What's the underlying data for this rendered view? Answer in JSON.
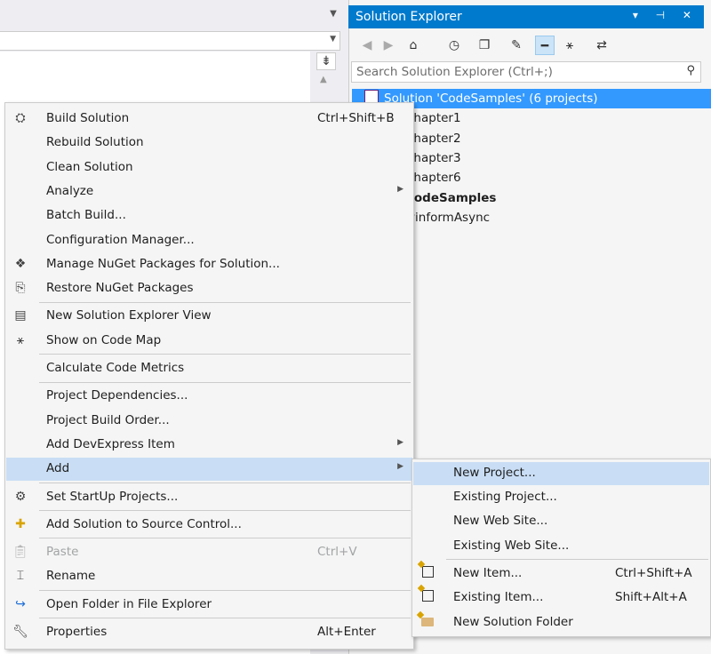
{
  "solution_explorer": {
    "title": "Solution Explorer",
    "title_buttons": "▾ ⊣ ✕",
    "search_placeholder": "Search Solution Explorer (Ctrl+;)",
    "search_icon": "⚲",
    "toolbar_icons": [
      "back-icon",
      "forward-icon",
      "home-icon",
      "history-icon",
      "collapse-all-icon",
      "properties-icon",
      "preview-icon",
      "code-map-icon",
      "sync-icon"
    ],
    "tree": [
      {
        "label": "Solution 'CodeSamples' (6 projects)",
        "selected": true
      },
      {
        "label": "Chapter1"
      },
      {
        "label": "Chapter2"
      },
      {
        "label": "Chapter3"
      },
      {
        "label": "Chapter6"
      },
      {
        "label": "CodeSamples",
        "bold": true
      },
      {
        "label": "winformAsync"
      }
    ]
  },
  "context_menu": {
    "build_solution": {
      "label": "Build Solution",
      "shortcut": "Ctrl+Shift+B"
    },
    "rebuild_solution": {
      "label": "Rebuild Solution"
    },
    "clean_solution": {
      "label": "Clean Solution"
    },
    "analyze": {
      "label": "Analyze"
    },
    "batch_build": {
      "label": "Batch Build..."
    },
    "configuration_manager": {
      "label": "Configuration Manager..."
    },
    "manage_nuget": {
      "label": "Manage NuGet Packages for Solution..."
    },
    "restore_nuget": {
      "label": "Restore NuGet Packages"
    },
    "new_se_view": {
      "label": "New Solution Explorer View"
    },
    "show_code_map": {
      "label": "Show on Code Map"
    },
    "calc_metrics": {
      "label": "Calculate Code Metrics"
    },
    "project_dependencies": {
      "label": "Project Dependencies..."
    },
    "project_build_order": {
      "label": "Project Build Order..."
    },
    "add_devexpress": {
      "label": "Add DevExpress Item"
    },
    "add": {
      "label": "Add"
    },
    "set_startup": {
      "label": "Set StartUp Projects..."
    },
    "add_source_control": {
      "label": "Add Solution to Source Control..."
    },
    "paste": {
      "label": "Paste",
      "shortcut": "Ctrl+V"
    },
    "rename": {
      "label": "Rename"
    },
    "open_folder": {
      "label": "Open Folder in File Explorer"
    },
    "properties": {
      "label": "Properties",
      "shortcut": "Alt+Enter"
    }
  },
  "add_submenu": {
    "new_project": {
      "label": "New Project..."
    },
    "existing_project": {
      "label": "Existing Project..."
    },
    "new_web_site": {
      "label": "New Web Site..."
    },
    "existing_web_site": {
      "label": "Existing Web Site..."
    },
    "new_item": {
      "label": "New Item...",
      "shortcut": "Ctrl+Shift+A"
    },
    "existing_item": {
      "label": "Existing Item...",
      "shortcut": "Shift+Alt+A"
    },
    "new_solution_folder": {
      "label": "New Solution Folder"
    }
  },
  "colors": {
    "accent": "#007acc",
    "highlight": "#c9def5",
    "selection": "#3399ff"
  }
}
